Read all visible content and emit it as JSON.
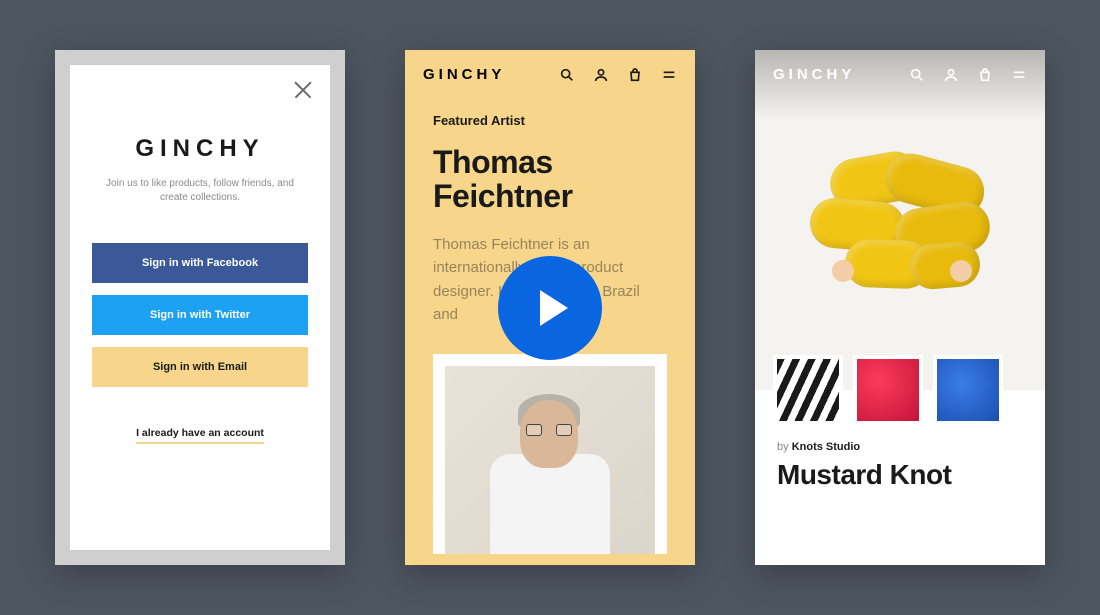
{
  "brand": "GINCHY",
  "screen1": {
    "subtext": "Join us to like products, follow friends, and create collections.",
    "fb": "Sign in with Facebook",
    "tw": "Sign in with Twitter",
    "em": "Sign in with Email",
    "already": "I already have an account"
  },
  "screen2": {
    "label": "Featured Artist",
    "name": "Thomas Feichtner",
    "bio": "Thomas Feichtner is an internationally active product designer. He was born in Brazil and"
  },
  "screen3": {
    "byline_prefix": "by",
    "byline_author": "Knots Studio",
    "title": "Mustard Knot"
  }
}
